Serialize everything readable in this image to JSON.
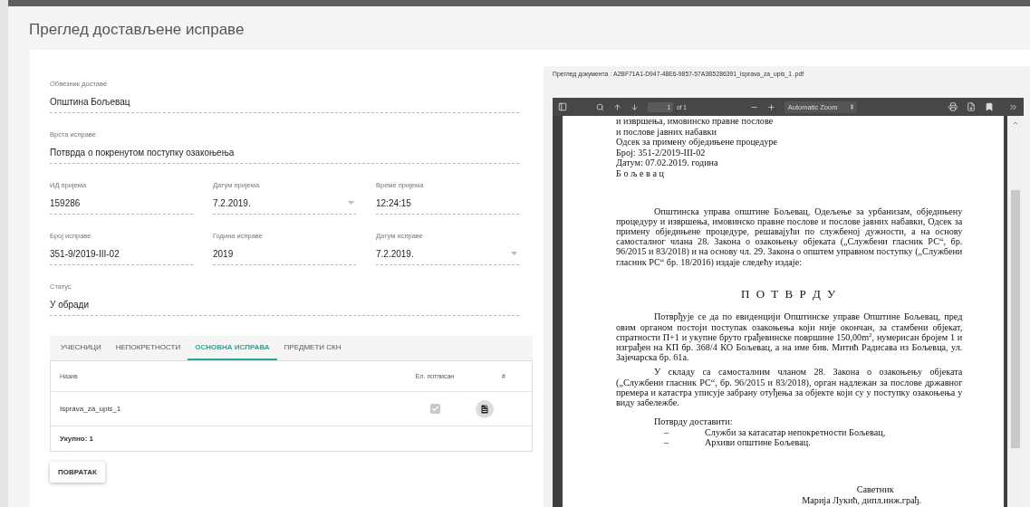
{
  "page_title": "Преглед достављене исправе",
  "form": {
    "rows": [
      [
        {
          "label": "Обвезник доставе",
          "value": "Општина Бољевац",
          "kind": "text"
        }
      ],
      [
        {
          "label": "Врста исправе",
          "value": "Потврда о покренутом поступку  озакоњења",
          "kind": "text"
        }
      ],
      [
        {
          "label": "ИД пријема",
          "value": "159286",
          "kind": "text"
        },
        {
          "label": "Датум пријема",
          "value": "7.2.2019.",
          "kind": "date"
        },
        {
          "label": "Време пријема",
          "value": "12:24:15",
          "kind": "text"
        }
      ],
      [
        {
          "label": "Број исправе",
          "value": "351-9/2019-III-02",
          "kind": "text"
        },
        {
          "label": "Година исправе",
          "value": "2019",
          "kind": "text"
        },
        {
          "label": "Датум исправе",
          "value": "7.2.2019.",
          "kind": "date"
        }
      ],
      [
        {
          "label": "Статус",
          "value": "У обради",
          "kind": "text"
        }
      ]
    ]
  },
  "tabs": [
    {
      "label": "УЧЕСНИЦИ",
      "selected": false
    },
    {
      "label": "НЕПОКРЕТНОСТИ",
      "selected": false
    },
    {
      "label": "ОСНОВНА ИСПРАВА",
      "selected": true
    },
    {
      "label": "ПРЕДМЕТИ СКН",
      "selected": false
    }
  ],
  "table": {
    "columns": [
      "Назив",
      "Ел. потписан",
      "#"
    ],
    "rows": [
      {
        "name": "Isprava_za_upis_1",
        "checked": true,
        "disabled": true
      }
    ],
    "footer": "Укупно: 1"
  },
  "back_button": "ПОВРАТАК",
  "viewer": {
    "title": "Преглед документа : A2BF71A1-D947-48E6-9857-57A3B5286391_Isprava_za_upis_1 .pdf",
    "toolbar": {
      "page": "1",
      "page_count": "of 1",
      "zoom": "Automatic Zoom"
    },
    "document": [
      {
        "kind": "line",
        "text": "и извршења, имовинско правне послове"
      },
      {
        "kind": "line",
        "text": "и послове јавних набавки"
      },
      {
        "kind": "line",
        "text": "Одсек за примену обједињене процедуре"
      },
      {
        "kind": "line",
        "text": "Број: 351-2/2019-III-02"
      },
      {
        "kind": "line",
        "text": "Датум: 07.02.2019. година"
      },
      {
        "kind": "line",
        "text": "Б о љ е в а ц"
      },
      {
        "kind": "paragraph",
        "text": "Општинска управа општине Бољевац, Одељење за урбанизам, обједињену процедуру и извршења, имовинско правне послове и послове јавних набавки, Одсек за примену обједињене процедуре, решавајући по службеној дужности, а на основу самосталног члана 28. Закона о озакоњењу објеката („Службени гласник РС“, бр. 96/2015 и 83/2018) и на основу чл. 29. Закона о општем управном поступку („Службени гласник РС“ бр. 18/2016) издаје следећу издаје:"
      },
      {
        "kind": "heading",
        "text": "П О Т В Р Д У"
      },
      {
        "kind": "paragraph",
        "text": "Потврђује се да по евиденцији Општинске управе Општине Бољевац, пред овим органом постоји поступак озакоњења који није окончан, за стамбени објекат, спратности П+1 и укупне бруто грађевинске површине 150,00m$^{2}$, нумерисан бројем 1 и изграђен на КП бр. 368/4 КО Бољевац, а на име бив. Митић Радисава из Бољевца, ул. Зајечарска бр. 61а."
      },
      {
        "kind": "paragraph",
        "text": "У складу са самосталним чланом 28. Закона о озакоњењу објеката („Службени гласник РС“, бр. 96/2015 и 83/2018), орган надлежан за послове државног премера и катастра уписује забрану отуђења за објекте који су у поступку озакоњења у виду забележбе."
      },
      {
        "kind": "note",
        "text": "Потврду доставити:"
      },
      {
        "kind": "bullet",
        "marker": "–",
        "text": "Служби за катасатар непокретности Бољевац,"
      },
      {
        "kind": "bullet",
        "marker": "–",
        "text": "Архиви општине Бољевац."
      },
      {
        "kind": "signature",
        "text": "Саветник"
      },
      {
        "kind": "signature",
        "text": "Марија Лукић, дипл.инж.грађ."
      }
    ]
  }
}
